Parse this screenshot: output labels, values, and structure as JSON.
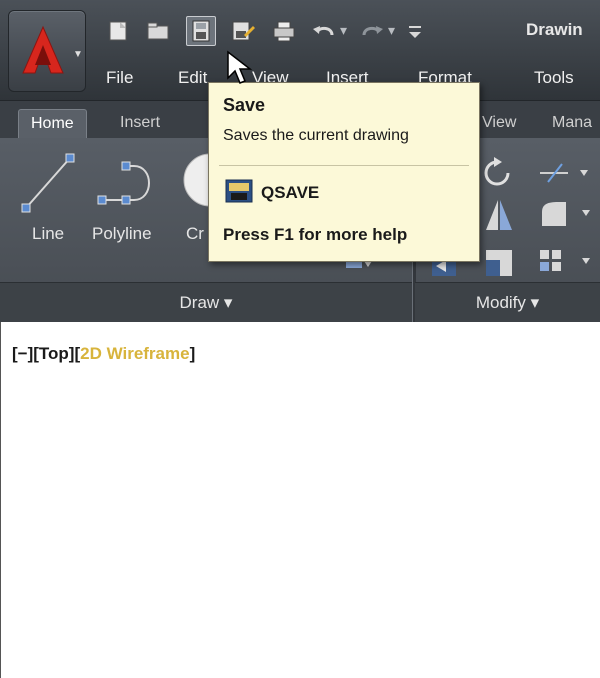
{
  "window": {
    "title": "Drawin"
  },
  "quick_access": {
    "icons": [
      "new-icon",
      "open-icon",
      "save-icon",
      "save-as-icon",
      "plot-icon",
      "undo-icon",
      "redo-icon",
      "customize-icon"
    ],
    "dropdown_glyph": "▾"
  },
  "menubar": {
    "items": [
      "File",
      "Edit",
      "View",
      "Insert",
      "Format",
      "Tools"
    ]
  },
  "ribbon": {
    "tabs": [
      "Home",
      "Insert",
      "View",
      "Mana"
    ],
    "active_tab": "Home",
    "draw_tools": [
      "Line",
      "Polyline",
      "Cr"
    ],
    "panels": {
      "draw": "Draw ▾",
      "modify": "Modify ▾"
    }
  },
  "tooltip": {
    "title": "Save",
    "description": "Saves the current drawing",
    "command": "QSAVE",
    "help": "Press F1 for more help"
  },
  "viewport": {
    "left": "[−][Top][",
    "style": "2D Wireframe",
    "right": "]"
  },
  "colors": {
    "accent_red": "#d7261d",
    "viewport_gold": "#d8b43c",
    "tooltip_bg": "#fcf9d8",
    "ribbon_dark": "#3a3f45"
  }
}
